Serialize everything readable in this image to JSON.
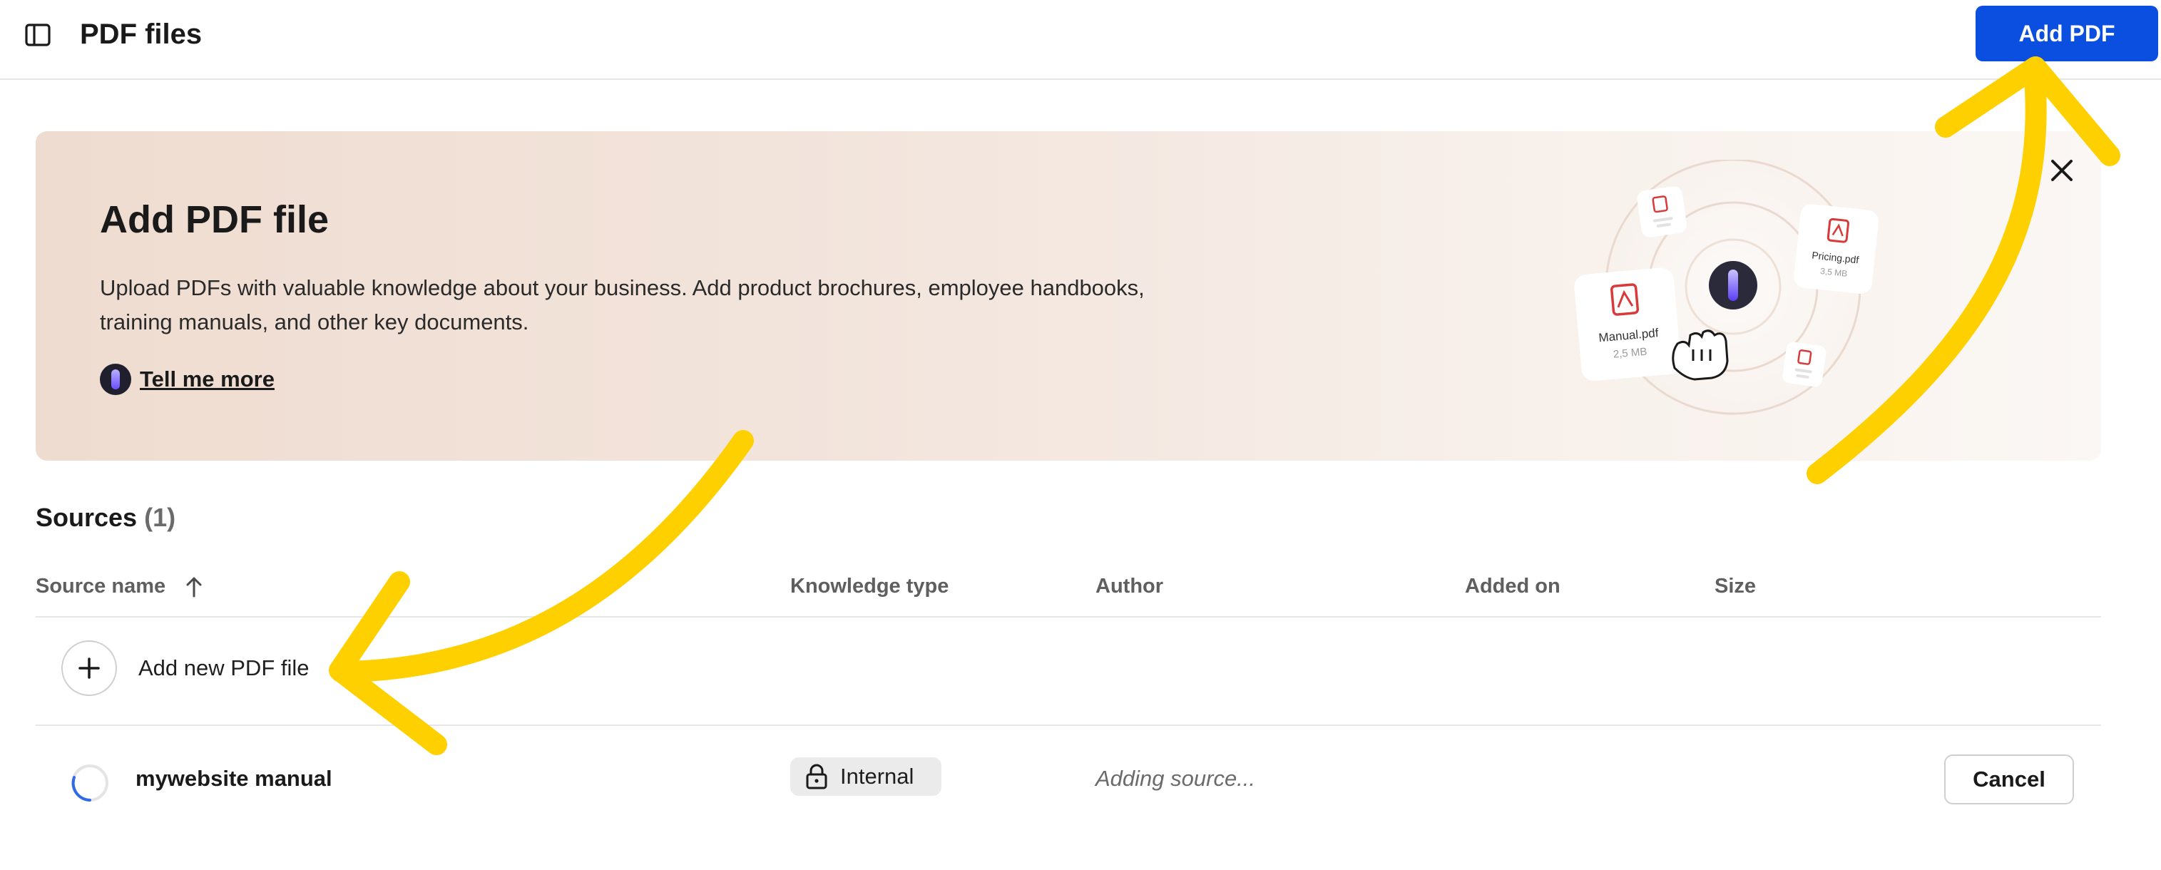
{
  "header": {
    "title": "PDF files",
    "sidebar_icon": "sidebar-toggle-icon",
    "add_button_label": "Add PDF"
  },
  "banner": {
    "title": "Add PDF file",
    "description": "Upload PDFs with valuable knowledge about your business. Add product brochures, employee handbooks, training manuals, and other key documents.",
    "link_label": "Tell me more",
    "close_icon": "close-icon",
    "illustration": {
      "files": [
        {
          "name": "Manual.pdf",
          "size": "2,5 MB"
        },
        {
          "name": "Pricing.pdf",
          "size": "3,5 MB"
        }
      ]
    }
  },
  "sources": {
    "title": "Sources",
    "count": "(1)",
    "columns": [
      "Source name",
      "Knowledge type",
      "Author",
      "Added on",
      "Size"
    ],
    "sort_icon": "arrow-up-icon",
    "add_new_label": "Add new PDF file",
    "rows": [
      {
        "name": "mywebsite manual",
        "knowledge_type": "Internal",
        "status": "Adding source...",
        "action": "Cancel"
      }
    ]
  },
  "colors": {
    "accent": "#0b4fe0",
    "annotation_arrow": "#ffd000",
    "banner_start": "#efdcd0",
    "banner_end": "#fbf7f4",
    "pdf_red": "#d83a3a"
  }
}
